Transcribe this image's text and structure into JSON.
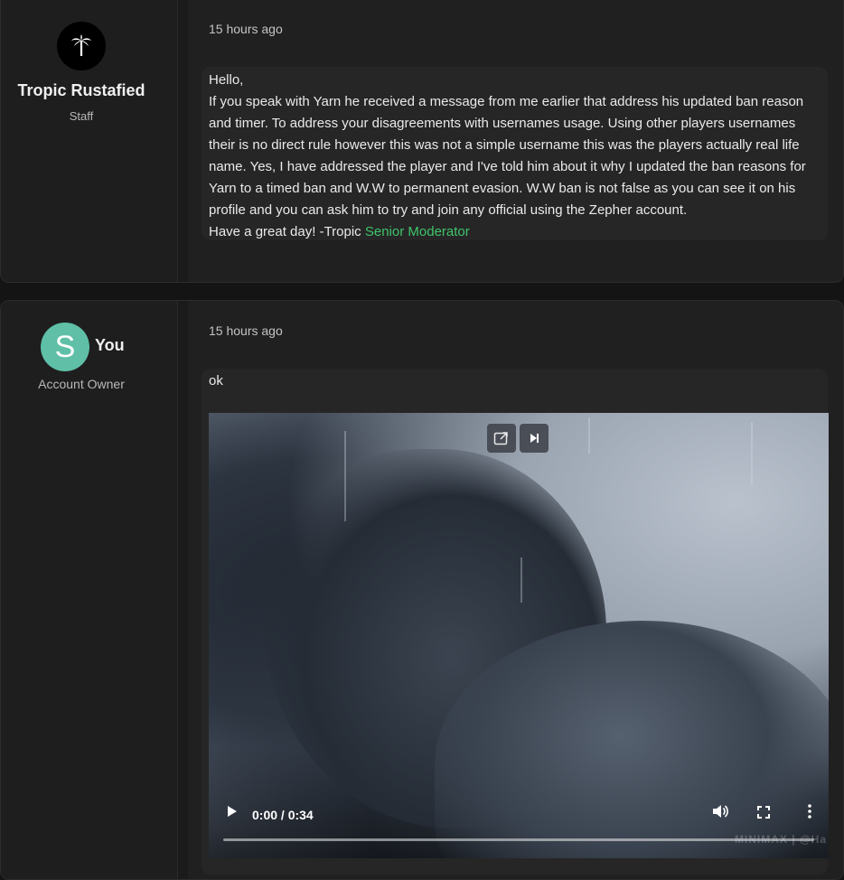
{
  "posts": [
    {
      "author": {
        "name": "Tropic Rustafied",
        "role": "Staff",
        "avatar_icon": "palm-tree-icon"
      },
      "timestamp": "15 hours ago",
      "message": {
        "greeting": "Hello,",
        "body": "If you speak with Yarn he received a message from me earlier that address his updated ban reason and timer. To address your disagreements with usernames usage. Using other players usernames their is no direct rule however this was not a simple username this was the players actually real life name. Yes, I have addressed the player and I've told him about it why I updated the ban reasons for Yarn to a timed ban and W.W to permanent evasion. W.W ban is not false as you can see it on his profile and you can ask him to try and join any official using the Zepher account.",
        "signoff": "Have a great day! -Tropic ",
        "signoff_role": "Senior Moderator"
      }
    },
    {
      "author": {
        "name": "You",
        "role": "Account Owner",
        "avatar_letter": "S",
        "avatar_color": "#5fbfa7"
      },
      "timestamp": "15 hours ago",
      "message": {
        "text": "ok"
      },
      "video": {
        "time": "0:00 / 0:34",
        "progress": 0,
        "watermark": "MINIMAX | @Ha",
        "controls": [
          "play-icon",
          "volume-icon",
          "fullscreen-icon",
          "more-options-icon"
        ],
        "overlay_buttons": [
          "picture-in-picture-icon",
          "skip-next-icon"
        ]
      }
    }
  ],
  "colors": {
    "role_highlight": "#3fc46a",
    "card_background": "#1f1f1f",
    "page_background": "#141414"
  }
}
